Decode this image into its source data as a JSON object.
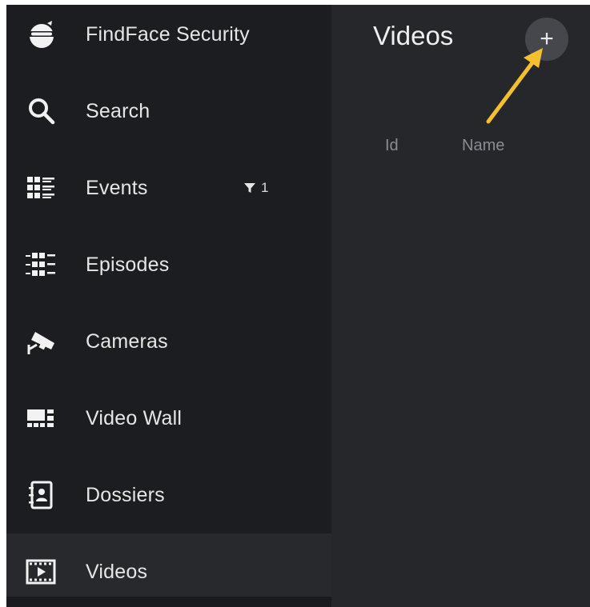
{
  "sidebar": {
    "items": [
      {
        "label": "FindFace Security",
        "icon": "findface-logo-icon"
      },
      {
        "label": "Search",
        "icon": "search-icon"
      },
      {
        "label": "Events",
        "icon": "events-icon",
        "filter_count": "1"
      },
      {
        "label": "Episodes",
        "icon": "episodes-icon"
      },
      {
        "label": "Cameras",
        "icon": "camera-icon"
      },
      {
        "label": "Video Wall",
        "icon": "video-wall-icon"
      },
      {
        "label": "Dossiers",
        "icon": "dossier-icon"
      },
      {
        "label": "Videos",
        "icon": "film-icon",
        "active": true
      }
    ]
  },
  "main": {
    "title": "Videos",
    "add_button_label": "+",
    "columns": [
      "Id",
      "Name"
    ]
  },
  "colors": {
    "sidebar_bg": "#1c1d20",
    "main_bg": "#25272b",
    "active_item_bg": "#27292d",
    "annotation_arrow": "#f5c02e"
  }
}
